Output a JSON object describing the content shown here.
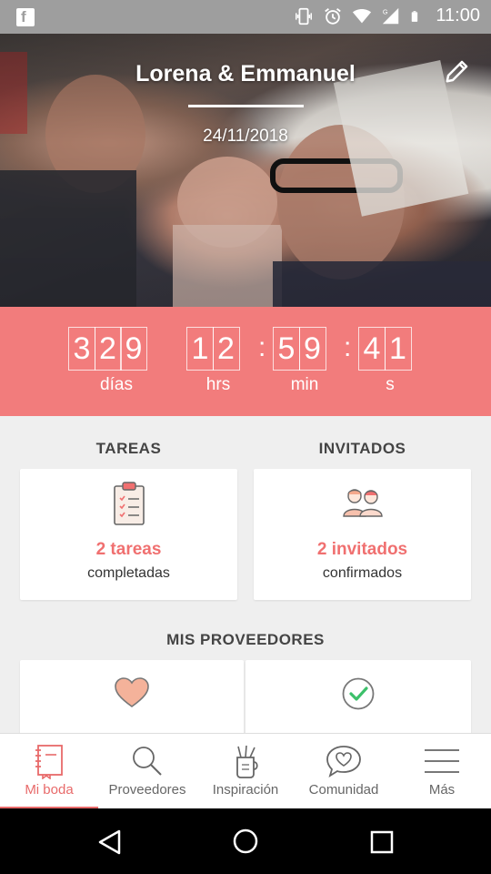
{
  "status_bar": {
    "time": "11:00"
  },
  "hero": {
    "couple_names": "Lorena & Emmanuel",
    "wedding_date": "24/11/2018"
  },
  "countdown": {
    "days": [
      "3",
      "2",
      "9"
    ],
    "hours": [
      "1",
      "2"
    ],
    "minutes": [
      "5",
      "9"
    ],
    "seconds": [
      "4",
      "1"
    ],
    "labels": {
      "days": "días",
      "hours": "hrs",
      "minutes": "min",
      "seconds": "s"
    }
  },
  "tasks": {
    "title": "TAREAS",
    "count": "2 tareas",
    "sub": "completadas"
  },
  "guests": {
    "title": "INVITADOS",
    "count": "2 invitados",
    "sub": "confirmados"
  },
  "providers": {
    "title": "MIS PROVEEDORES"
  },
  "nav": {
    "items": [
      {
        "label": "Mi boda",
        "icon": "notebook-icon"
      },
      {
        "label": "Proveedores",
        "icon": "search-icon"
      },
      {
        "label": "Inspiración",
        "icon": "inspiration-icon"
      },
      {
        "label": "Comunidad",
        "icon": "chat-heart-icon"
      },
      {
        "label": "Más",
        "icon": "menu-icon"
      }
    ]
  },
  "colors": {
    "accent": "#f27c7c",
    "accent_text": "#f07070",
    "background": "#efefef"
  }
}
